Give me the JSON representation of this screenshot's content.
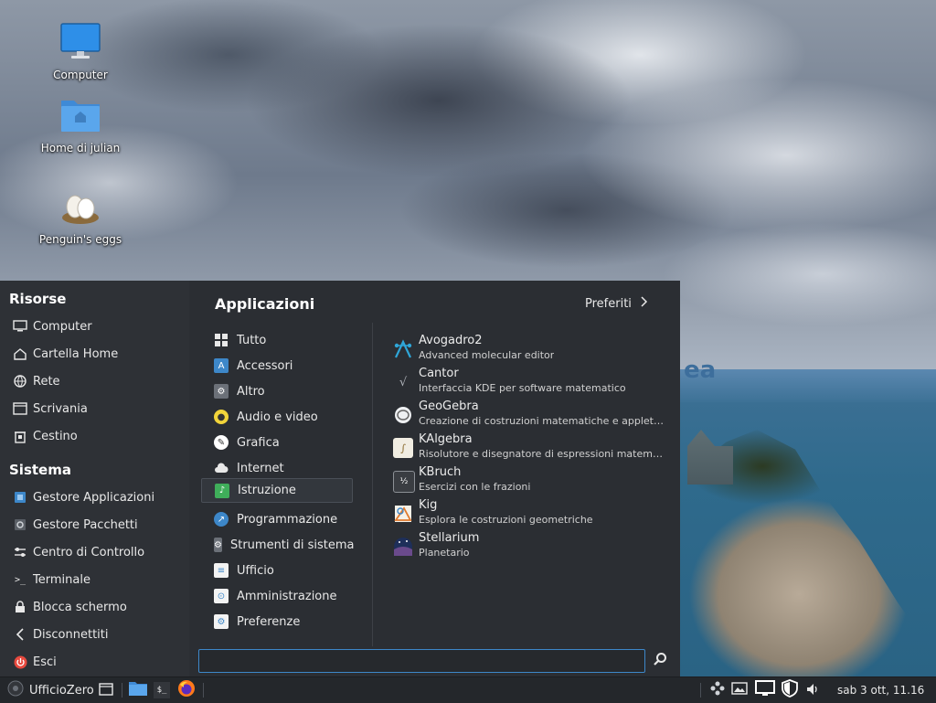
{
  "desktop": {
    "icons": [
      {
        "label": "Computer"
      },
      {
        "label": "Home di julian"
      },
      {
        "label": "Penguin's eggs"
      }
    ],
    "wallpaper_text": "ea"
  },
  "menu": {
    "risorse": {
      "title": "Risorse",
      "items": [
        "Computer",
        "Cartella Home",
        "Rete",
        "Scrivania",
        "Cestino"
      ]
    },
    "sistema": {
      "title": "Sistema",
      "items": [
        "Gestore Applicazioni",
        "Gestore Pacchetti",
        "Centro di Controllo",
        "Terminale",
        "Blocca schermo",
        "Disconnettiti",
        "Esci"
      ]
    },
    "apps_title": "Applicazioni",
    "favorites_label": "Preferiti",
    "categories": [
      "Tutto",
      "Accessori",
      "Altro",
      "Audio e video",
      "Grafica",
      "Internet",
      "Istruzione",
      "Programmazione",
      "Strumenti di sistema",
      "Ufficio",
      "Amministrazione",
      "Preferenze"
    ],
    "selected_category": "Istruzione",
    "apps": [
      {
        "name": "Avogadro2",
        "desc": "Advanced molecular editor"
      },
      {
        "name": "Cantor",
        "desc": "Interfaccia KDE per software matematico"
      },
      {
        "name": "GeoGebra",
        "desc": "Creazione di costruzioni matematiche e applet int..."
      },
      {
        "name": "KAlgebra",
        "desc": "Risolutore e disegnatore di espressioni matematiche"
      },
      {
        "name": "KBruch",
        "desc": "Esercizi con le frazioni"
      },
      {
        "name": "Kig",
        "desc": "Esplora le costruzioni geometriche"
      },
      {
        "name": "Stellarium",
        "desc": "Planetario"
      }
    ],
    "search_value": ""
  },
  "taskbar": {
    "start_label": "UfficioZero",
    "clock": "sab  3 ott, 11.16"
  },
  "colors": {
    "accent": "#3d87c9",
    "menu_bg": "#2b2e33",
    "taskbar_bg": "#24272b"
  }
}
